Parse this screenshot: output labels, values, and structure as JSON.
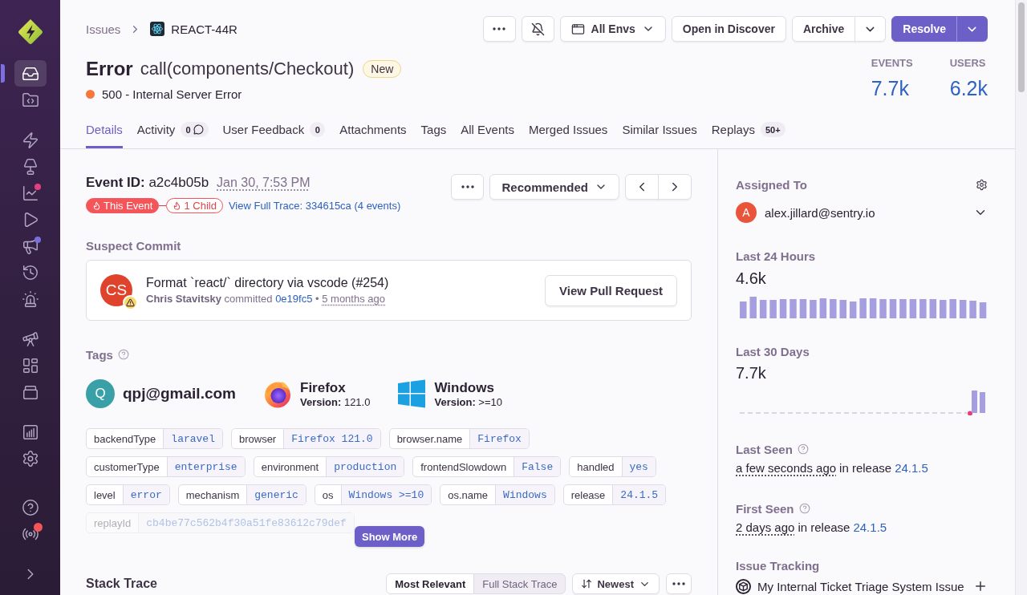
{
  "sidebar": {
    "groups": [
      {
        "items": [
          {
            "selected": true
          },
          {
            "selected": false
          }
        ]
      },
      {
        "items": [
          {
            "selected": false
          },
          {
            "selected": false
          },
          {
            "selected": false,
            "dot": {
              "color": "#e5407d"
            }
          },
          {
            "selected": false
          },
          {
            "selected": false,
            "dot": {
              "color": "#7a6fdb"
            }
          },
          {
            "selected": false
          },
          {
            "selected": false
          }
        ]
      },
      {
        "items": [
          {
            "selected": false
          },
          {
            "selected": false
          },
          {
            "selected": false
          }
        ]
      },
      {
        "items": [
          {
            "selected": false
          },
          {
            "selected": false
          }
        ]
      },
      {
        "items": [
          {
            "selected": false
          },
          {
            "selected": false,
            "dot": {
              "color": "#f55459"
            }
          }
        ]
      }
    ]
  },
  "breadcrumbs": [
    {
      "label": "Issues",
      "kind": "link"
    },
    {
      "label": "REACT-44R",
      "kind": "project"
    }
  ],
  "toolbar": [
    {
      "kind": "more"
    },
    {
      "kind": "mute"
    },
    {
      "kind": "env",
      "label": "All Envs"
    },
    {
      "kind": "plain",
      "label": "Open in Discover"
    },
    {
      "kind": "split",
      "label": "Archive",
      "primary": false
    },
    {
      "kind": "split",
      "label": "Resolve",
      "primary": true
    }
  ],
  "issue": {
    "level": "Error",
    "title": "call(components/Checkout)",
    "badge": "New",
    "message": "500 - Internal Server Error"
  },
  "stats": [
    {
      "label": "EVENTS",
      "value": "7.7k"
    },
    {
      "label": "USERS",
      "value": "6.2k"
    }
  ],
  "tabs": [
    {
      "label": "Details",
      "selected": true,
      "kind": "plain"
    },
    {
      "label": "Activity",
      "selected": false,
      "kind": "comments",
      "count": "0"
    },
    {
      "label": "User Feedback",
      "selected": false,
      "kind": "count",
      "count": "0"
    },
    {
      "label": "Attachments",
      "selected": false,
      "kind": "plain"
    },
    {
      "label": "Tags",
      "selected": false,
      "kind": "plain"
    },
    {
      "label": "All Events",
      "selected": false,
      "kind": "plain"
    },
    {
      "label": "Merged Issues",
      "selected": false,
      "kind": "plain"
    },
    {
      "label": "Similar Issues",
      "selected": false,
      "kind": "plain"
    },
    {
      "label": "Replays",
      "selected": false,
      "kind": "count",
      "count": "50+"
    }
  ],
  "event": {
    "id_line": "**Event ID:** a2c4b05b",
    "date": "Jan 30, 7:53 PM",
    "trace": [
      {
        "label": "This Event",
        "selected": true
      },
      {
        "label": "1 Child",
        "selected": false
      }
    ],
    "trace_link": "View Full Trace: 334615ca (4 events)",
    "sort": "Recommended"
  },
  "suspect_commit": {
    "heading": "Suspect Commit",
    "initials": "CS",
    "message": "Format `react/` directory via vscode (#254)",
    "byline": "**Chris Stavitsky** committed",
    "hash": "0e19fc5",
    "separator": "•",
    "age": "5 months ago",
    "action": "View Pull Request"
  },
  "tags": {
    "heading": "Tags",
    "highlights": [
      {
        "kind": "user",
        "initial": "Q",
        "title": "qpj@gmail.com"
      },
      {
        "kind": "browser",
        "title": "Firefox",
        "version": "**Version:** 121.0"
      },
      {
        "kind": "os",
        "title": "Windows",
        "version": "**Version:** >=10"
      }
    ],
    "items": [
      {
        "key": "backendType",
        "value": "laravel",
        "faded": false
      },
      {
        "key": "browser",
        "value": "Firefox 121.0",
        "faded": false
      },
      {
        "key": "browser.name",
        "value": "Firefox",
        "faded": false
      },
      {
        "key": "customerType",
        "value": "enterprise",
        "faded": false
      },
      {
        "key": "environment",
        "value": "production",
        "faded": false
      },
      {
        "key": "frontendSlowdown",
        "value": "False",
        "faded": false
      },
      {
        "key": "handled",
        "value": "yes",
        "faded": false
      },
      {
        "key": "level",
        "value": "error",
        "faded": false
      },
      {
        "key": "mechanism",
        "value": "generic",
        "faded": false
      },
      {
        "key": "os",
        "value": "Windows >=10",
        "faded": false
      },
      {
        "key": "os.name",
        "value": "Windows",
        "faded": false
      },
      {
        "key": "release",
        "value": "24.1.5",
        "faded": false
      },
      {
        "key": "replayId",
        "value": "cb4be77c562b4f30a51fe83612c79def",
        "faded": true
      }
    ],
    "show_more": "Show More"
  },
  "stack_trace": {
    "heading": "Stack Trace",
    "views": [
      {
        "label": "Most Relevant",
        "selected": true
      },
      {
        "label": "Full Stack Trace",
        "selected": false
      }
    ],
    "sort": "Newest"
  },
  "details": {
    "assigned": {
      "heading": "Assigned To",
      "initial": "A",
      "email": "alex.jillard@sentry.io"
    },
    "activity": [
      {
        "heading": "Last 24 Hours",
        "total": "4.6k",
        "kind": "hourly"
      },
      {
        "heading": "Last 30 Days",
        "total": "7.7k",
        "kind": "daily"
      }
    ],
    "seen": [
      {
        "heading": "Last Seen",
        "when": "a few seconds ago",
        "joiner": "in release",
        "release": "24.1.5"
      },
      {
        "heading": "First Seen",
        "when": "2 days ago",
        "joiner": "in release",
        "release": "24.1.5"
      }
    ],
    "tracking": {
      "heading": "Issue Tracking",
      "items": [
        {
          "label": "My Internal Ticket Triage System Issue"
        }
      ]
    }
  }
}
